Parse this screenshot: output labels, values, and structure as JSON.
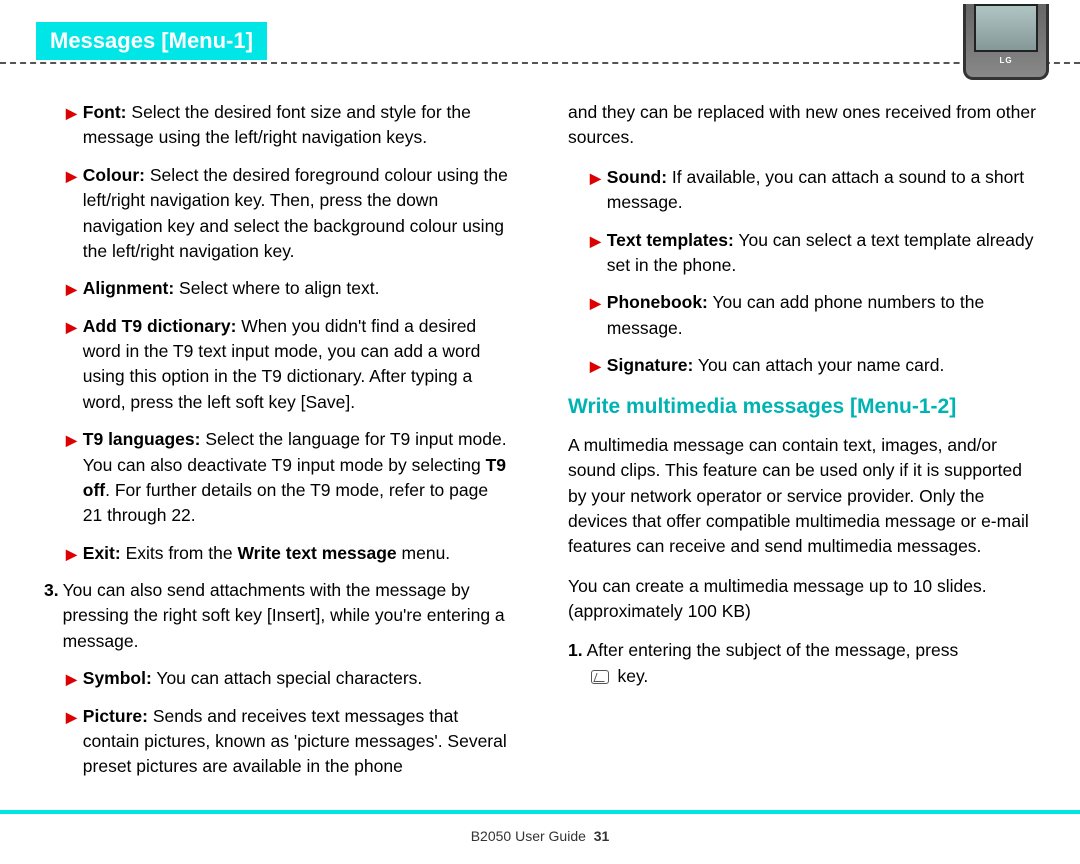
{
  "header": {
    "tab": "Messages [Menu-1]",
    "phone_brand": "LG"
  },
  "left": {
    "items": [
      {
        "label": "Font:",
        "body": "Select the desired font size and style for the message using the left/right navigation keys."
      },
      {
        "label": "Colour:",
        "body": "Select the desired foreground colour using the left/right navigation key. Then, press the down navigation key and select the background colour using the left/right navigation key."
      },
      {
        "label": "Alignment:",
        "body": "Select where to align text."
      },
      {
        "label": "Add T9 dictionary:",
        "body": "When you didn't find a desired word in the T9 text input mode, you can add a word using this option in the T9 dictionary. After typing a word, press the left soft key [Save]."
      },
      {
        "label": "T9 languages:",
        "body_pre": "Select the language for T9 input mode. You can also deactivate T9 input mode by selecting",
        "bold_inline": "T9 off",
        "body_post": ". For further details on the T9 mode, refer to page 21 through 22."
      },
      {
        "label": "Exit:",
        "body_pre": "Exits from the",
        "bold_inline": "Write text message",
        "body_post": "menu."
      }
    ],
    "step3": {
      "num": "3.",
      "body": "You can also send attachments with the message by pressing the right soft key [Insert], while you're entering a message."
    },
    "items2": [
      {
        "label": "Symbol:",
        "body": "You can attach special characters."
      },
      {
        "label": "Picture:",
        "body": "Sends and receives text messages that contain pictures, known as 'picture messages'. Several preset pictures are available in the phone"
      }
    ]
  },
  "right": {
    "picture_cont": "and they can be replaced with new ones received from other sources.",
    "items": [
      {
        "label": "Sound:",
        "body": "If available, you can attach a sound to a short message."
      },
      {
        "label": "Text templates:",
        "body": "You can select a text template already set in the phone."
      },
      {
        "label": "Phonebook:",
        "body": "You can add phone numbers to the message."
      },
      {
        "label": "Signature:",
        "body": "You can attach your name card."
      }
    ],
    "subheading": "Write multimedia messages [Menu-1-2]",
    "mms_para1": "A multimedia message can contain text, images, and/or sound clips. This feature can be used only if it is supported by your network operator or service provider. Only the devices that offer compatible multimedia message or e-mail features can receive and send multimedia messages.",
    "mms_para2": "You can create a multimedia message up to 10 slides. (approximately 100 KB)",
    "step1": {
      "num": "1.",
      "body_pre": "After entering the subject of the message, press",
      "body_post": " key."
    }
  },
  "footer": {
    "guide": "B2050 User Guide",
    "page": "31"
  }
}
